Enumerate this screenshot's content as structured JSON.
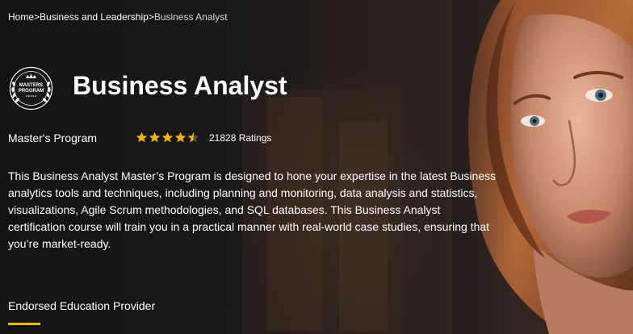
{
  "breadcrumb": {
    "home": "Home",
    "separator": ">",
    "category": "Business and Leadership",
    "current": "Business Analyst"
  },
  "badge": {
    "line1": "MASTERS",
    "line2": "PROGRAM",
    "icon": "laurel-crown-badge-icon"
  },
  "title": "Business Analyst",
  "program_type": "Master's Program",
  "rating": {
    "stars": 4.5,
    "max_stars": 5,
    "count_label": "21828 Ratings",
    "star_color": "#f4b400"
  },
  "description": "This Business Analyst Master’s Program is designed to hone your expertise in the latest Business analytics tools and techniques, including planning and monitoring, data analysis and statistics, visualizations, Agile Scrum methodologies, and SQL databases. This Business Analyst certification course will train you in a practical manner with real-world case studies, ensuring that you’re market-ready.",
  "endorsed": {
    "label": "Endorsed Education Provider",
    "accent_color": "#f4b400"
  }
}
